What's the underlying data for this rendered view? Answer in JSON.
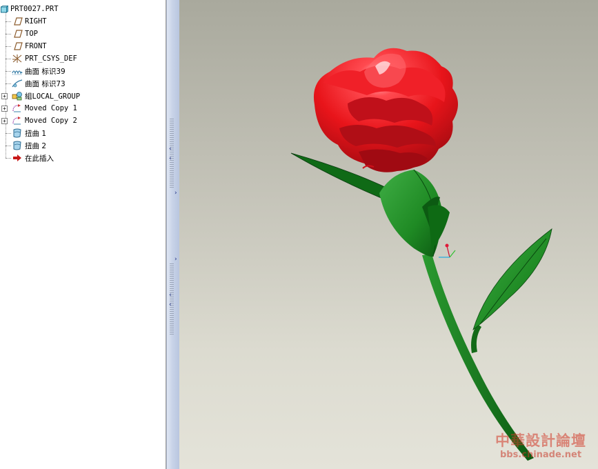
{
  "model_tree": {
    "root": "PRT0027.PRT",
    "items": [
      {
        "label": "RIGHT",
        "icon": "datum-plane-icon",
        "expandable": false
      },
      {
        "label": "TOP",
        "icon": "datum-plane-icon",
        "expandable": false
      },
      {
        "label": "FRONT",
        "icon": "datum-plane-icon",
        "expandable": false
      },
      {
        "label": "PRT_CSYS_DEF",
        "icon": "coordinate-system-icon",
        "expandable": false
      },
      {
        "label": "曲面 标识39",
        "icon": "surface-icon",
        "expandable": false
      },
      {
        "label": "曲面 标识73",
        "icon": "surface-icon",
        "expandable": false
      },
      {
        "label": "組LOCAL_GROUP",
        "icon": "group-icon",
        "expandable": true
      },
      {
        "label": "Moved Copy 1",
        "icon": "moved-copy-icon",
        "expandable": true
      },
      {
        "label": "Moved Copy 2",
        "icon": "moved-copy-icon",
        "expandable": true
      },
      {
        "label": "扭曲 1",
        "icon": "warp-icon",
        "expandable": false
      },
      {
        "label": "扭曲 2",
        "icon": "warp-icon",
        "expandable": false
      },
      {
        "label": "在此插入",
        "icon": "insert-here-arrow-icon",
        "expandable": false
      }
    ]
  },
  "viewport": {
    "subject": "rose model",
    "background_top": "#a9a99d",
    "background_bottom": "#e4e3d9",
    "petal_color": "#e8141a",
    "leaf_color": "#1f8a24"
  },
  "watermark": {
    "line1": "中華設計論壇",
    "line2": "bbs.chinade.net"
  }
}
